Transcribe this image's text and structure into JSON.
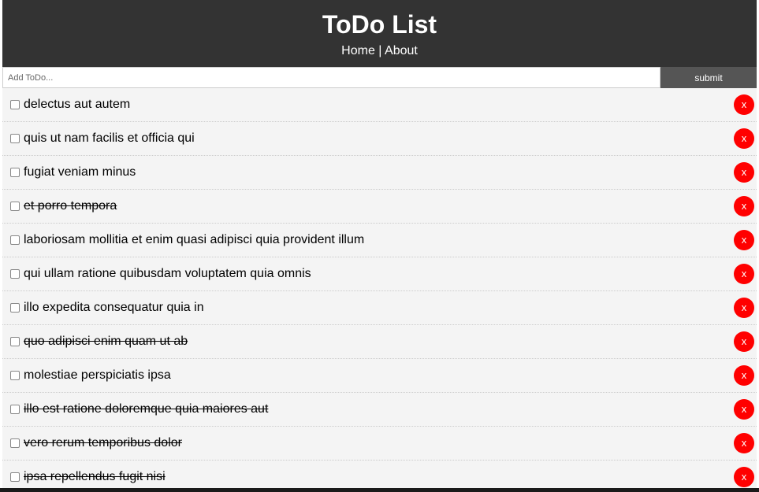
{
  "header": {
    "title": "ToDo List",
    "nav_home": "Home",
    "nav_separator": " | ",
    "nav_about": "About"
  },
  "form": {
    "placeholder": "Add ToDo...",
    "submit_label": "submit"
  },
  "colors": {
    "header_bg": "#333333",
    "delete_button": "#ff0000",
    "submit_bg": "#555555",
    "item_bg": "#f4f4f4"
  },
  "todos": [
    {
      "title": "delectus aut autem",
      "completed": false,
      "delete_label": "x"
    },
    {
      "title": "quis ut nam facilis et officia qui",
      "completed": false,
      "delete_label": "x"
    },
    {
      "title": "fugiat veniam minus",
      "completed": false,
      "delete_label": "x"
    },
    {
      "title": "et porro tempora",
      "completed": true,
      "delete_label": "x"
    },
    {
      "title": "laboriosam mollitia et enim quasi adipisci quia provident illum",
      "completed": false,
      "delete_label": "x"
    },
    {
      "title": "qui ullam ratione quibusdam voluptatem quia omnis",
      "completed": false,
      "delete_label": "x"
    },
    {
      "title": "illo expedita consequatur quia in",
      "completed": false,
      "delete_label": "x"
    },
    {
      "title": "quo adipisci enim quam ut ab",
      "completed": true,
      "delete_label": "x"
    },
    {
      "title": "molestiae perspiciatis ipsa",
      "completed": false,
      "delete_label": "x"
    },
    {
      "title": "illo est ratione doloremque quia maiores aut",
      "completed": true,
      "delete_label": "x"
    },
    {
      "title": "vero rerum temporibus dolor",
      "completed": true,
      "delete_label": "x"
    },
    {
      "title": "ipsa repellendus fugit nisi",
      "completed": true,
      "delete_label": "x"
    }
  ]
}
